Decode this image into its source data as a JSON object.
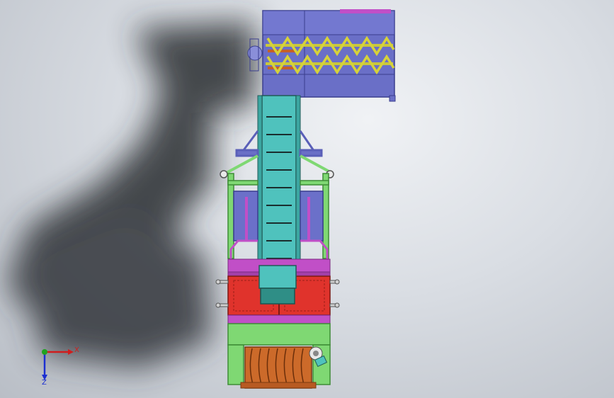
{
  "viewport": {
    "background_top": "#eef1f4",
    "background_bottom": "#b9bec6"
  },
  "colors": {
    "hopper_frame": "#7b7fd6",
    "hopper_bg": "#6a6fc7",
    "auger_flight": "#d6d23a",
    "auger_shaft": "#c4602a",
    "conveyor": "#4fc2bd",
    "conveyor_slat": "#1a2e2e",
    "frame_green": "#7fd873",
    "frame_magenta": "#c14fc7",
    "press_red": "#e0332c",
    "chute_teal": "#2f8e86",
    "orange_bale": "#cc6a2a",
    "shadow": "#2b2d31"
  },
  "triad": {
    "x_label": "X",
    "z_label": "Z",
    "x_color": "#d01d1d",
    "y_color": "#1fa31f",
    "z_color": "#1c2fd1"
  }
}
